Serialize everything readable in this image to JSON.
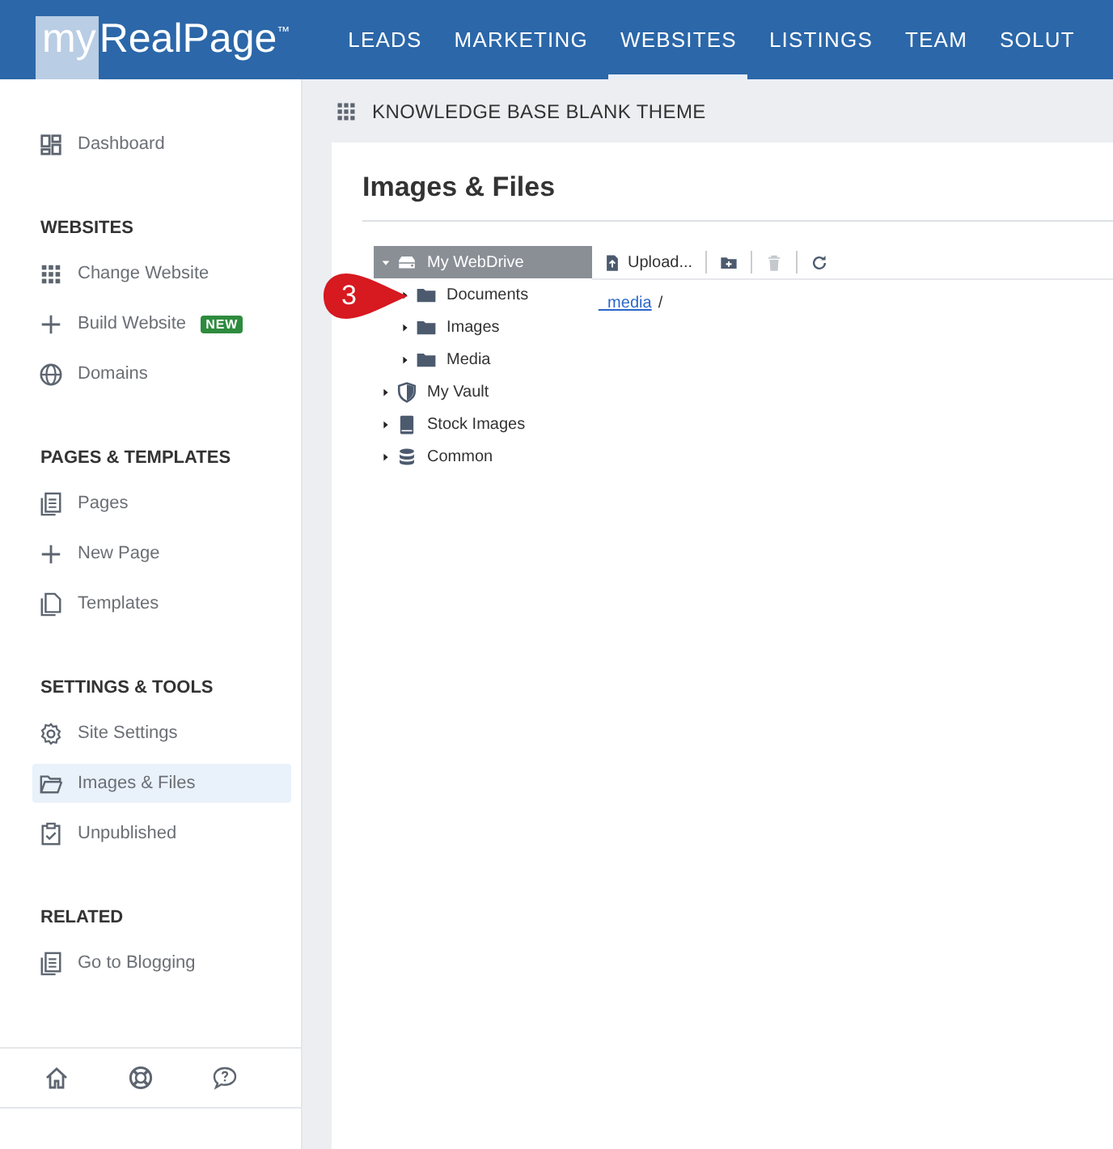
{
  "header": {
    "logo": {
      "prefix": "my",
      "name": "RealPage",
      "mark": "™"
    },
    "nav": [
      {
        "label": "LEADS",
        "selected": false
      },
      {
        "label": "MARKETING",
        "selected": false
      },
      {
        "label": "WEBSITES",
        "selected": true
      },
      {
        "label": "LISTINGS",
        "selected": false
      },
      {
        "label": "TEAM",
        "selected": false
      },
      {
        "label": "SOLUT",
        "selected": false
      }
    ]
  },
  "sidebar": {
    "sections": [
      {
        "items": [
          {
            "label": "Dashboard",
            "kind": "dashboard",
            "selected": false
          }
        ]
      },
      {
        "heading": "WEBSITES",
        "items": [
          {
            "label": "Change Website",
            "kind": "grid",
            "selected": false
          },
          {
            "label": "Build Website",
            "kind": "plus",
            "selected": false,
            "badge": "NEW"
          },
          {
            "label": "Domains",
            "kind": "globe",
            "selected": false
          }
        ]
      },
      {
        "heading": "PAGES & TEMPLATES",
        "items": [
          {
            "label": "Pages",
            "kind": "pages",
            "selected": false
          },
          {
            "label": "New Page",
            "kind": "plus",
            "selected": false
          },
          {
            "label": "Templates",
            "kind": "templates",
            "selected": false
          }
        ]
      },
      {
        "heading": "SETTINGS & TOOLS",
        "items": [
          {
            "label": "Site Settings",
            "kind": "gear",
            "selected": false
          },
          {
            "label": "Images & Files",
            "kind": "folder-open",
            "selected": true
          },
          {
            "label": "Unpublished",
            "kind": "clipboard",
            "selected": false
          }
        ]
      },
      {
        "heading": "RELATED",
        "items": [
          {
            "label": "Go to Blogging",
            "kind": "pages",
            "selected": false
          }
        ]
      }
    ]
  },
  "workspace_title": "KNOWLEDGE BASE BLANK THEME",
  "page_title": "Images & Files",
  "tree": [
    {
      "label": "My WebDrive",
      "kind": "drive",
      "expanded": true,
      "selected": true,
      "children": [
        {
          "label": "Documents",
          "kind": "folder",
          "expanded": false,
          "selected": false
        },
        {
          "label": "Images",
          "kind": "folder",
          "expanded": false,
          "selected": false
        },
        {
          "label": "Media",
          "kind": "folder",
          "expanded": false,
          "selected": false
        }
      ]
    },
    {
      "label": "My Vault",
      "kind": "shield",
      "expanded": false,
      "selected": false
    },
    {
      "label": "Stock Images",
      "kind": "book",
      "expanded": false,
      "selected": false
    },
    {
      "label": "Common",
      "kind": "database",
      "expanded": false,
      "selected": false
    }
  ],
  "toolbar": [
    {
      "kind": "upload",
      "label": "Upload...",
      "disabled": false
    },
    {
      "kind": "new-folder",
      "disabled": false
    },
    {
      "kind": "delete",
      "disabled": true
    },
    {
      "kind": "refresh",
      "disabled": false
    }
  ],
  "path": [
    {
      "kind": "link",
      "label": "_media"
    },
    {
      "kind": "separator",
      "label": "/"
    }
  ],
  "callout": {
    "label": "3"
  }
}
